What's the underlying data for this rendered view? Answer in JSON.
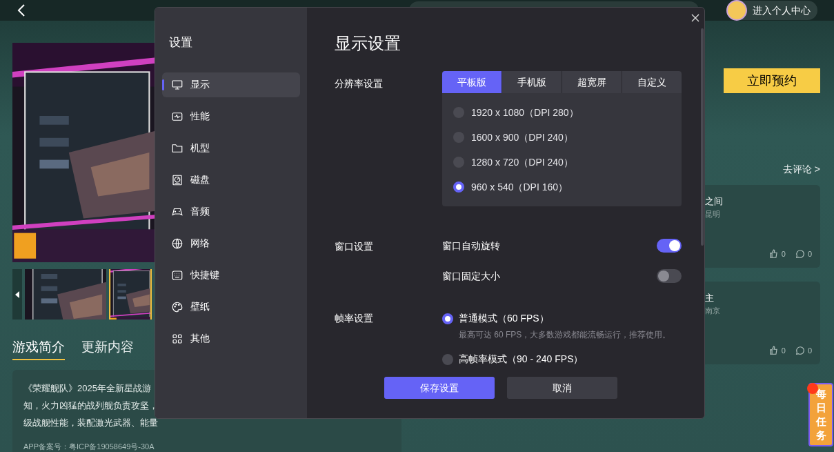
{
  "header": {
    "profile": "进入个人中心"
  },
  "game": {
    "reserve_button": "立即预约",
    "tabs": [
      {
        "label": "游戏简介",
        "selected": true
      },
      {
        "label": "更新内容",
        "selected": false
      }
    ],
    "intro_lines": [
      "《荣耀舰队》2025年全新星战游",
      "知，火力凶猛的战列舰负责攻坚，",
      "级战舰性能，装配激光武器、能量"
    ],
    "icp": "APP备案号：粤ICP备19058649号-30A"
  },
  "comments": {
    "link": "去评论 >",
    "cards": [
      {
        "title": "之间",
        "city": "昆明",
        "likes": "0",
        "replies": "0"
      },
      {
        "title": "主",
        "city": "南京",
        "likes": "0",
        "replies": "0"
      }
    ]
  },
  "daily_task": "每日任务",
  "settings": {
    "title": "设置",
    "sidebar": [
      {
        "label": "显示",
        "selected": true
      },
      {
        "label": "性能",
        "selected": false
      },
      {
        "label": "机型",
        "selected": false
      },
      {
        "label": "磁盘",
        "selected": false
      },
      {
        "label": "音频",
        "selected": false
      },
      {
        "label": "网络",
        "selected": false
      },
      {
        "label": "快捷键",
        "selected": false
      },
      {
        "label": "壁纸",
        "selected": false
      },
      {
        "label": "其他",
        "selected": false
      }
    ],
    "heading": "显示设置",
    "resolution": {
      "label": "分辨率设置",
      "tabs": [
        {
          "label": "平板版",
          "selected": true
        },
        {
          "label": "手机版",
          "selected": false
        },
        {
          "label": "超宽屏",
          "selected": false
        },
        {
          "label": "自定义",
          "selected": false
        }
      ],
      "options": [
        {
          "label": "1920 x 1080（DPI 280）",
          "selected": false
        },
        {
          "label": "1600 x 900（DPI 240）",
          "selected": false
        },
        {
          "label": "1280 x 720（DPI 240）",
          "selected": false
        },
        {
          "label": "960 x 540（DPI 160）",
          "selected": true
        }
      ]
    },
    "window": {
      "label": "窗口设置",
      "toggles": [
        {
          "label": "窗口自动旋转",
          "on": true
        },
        {
          "label": "窗口固定大小",
          "on": false
        }
      ]
    },
    "framerate": {
      "label": "帧率设置",
      "options": [
        {
          "label": "普通模式（60 FPS）",
          "hint": "最高可达 60 FPS，大多数游戏都能流畅运行，推荐使用。",
          "selected": true
        },
        {
          "label": "高帧率模式（90 - 240 FPS）",
          "selected": false
        }
      ]
    },
    "buttons": {
      "save": "保存设置",
      "cancel": "取消"
    }
  }
}
